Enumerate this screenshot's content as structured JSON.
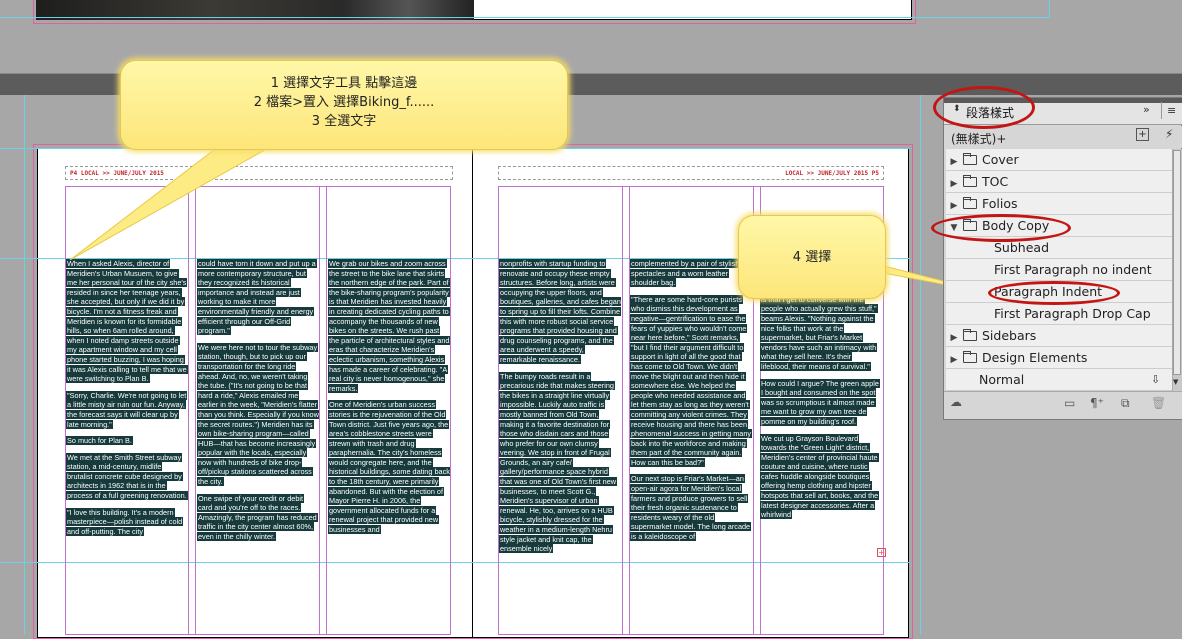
{
  "callout1": {
    "line1": "1 選擇文字工具 點擊這邊",
    "line2": "2 檔案>置入 選擇Biking_f......",
    "line3": "3 全選文字"
  },
  "callout2": {
    "text": "4 選擇"
  },
  "spread": {
    "left_folio": "P4     LOCAL >> JUNE/JULY 2015",
    "right_folio": "LOCAL >> JUNE/JULY 2015     P5",
    "columns": [
      [
        "When I asked Alexis, director of Meridien's Urban Musuem, to give me her personal tour of the city she's resided in since her teenage years, she accepted, but only if we did it by bicycle. I'm not a fitness freak and Meridien is known for its formidable hills, so when 6am rolled around, when I noted damp streets outside my apartment window and my cell phone started buzzing, I was hoping it was Alexis calling to tell me that we were switching to Plan B.",
        "\"Sorry, Charlie. We're not going to let a little misty air ruin our fun. Anyway, the forecast says it will clear up by late morning.\"",
        "So much for Plan B.",
        "We met at the Smith Street subway station, a mid-century, midlife brutalist concrete cube designed by architects in 1962 that is in the process of a full greening renovation.",
        "\"I love this building. It's a modern masterpiece—polish instead of cold and off-putting. The city"
      ],
      [
        "could have torn it down and put up a more contemporary structure, but they recognized its historical importance and instead are just working to make it more environmentally friendly and energy efficient through our Off-Grid program.\"",
        "We were here not to tour the subway station, though, but to pick up our transportation for the long ride ahead. And, no, we weren't taking the tube. (\"It's not going to be that hard a ride,\" Alexis emailed me earlier in the week, \"Meridien's flatter than you think. Especially if you know the secret routes.\") Meridien has its own bike-sharing program—called HUB—that has become increasingly popular with the locals, especially now with hundreds of bike drop-off/pickup stations scattered across the city.",
        "One swipe of your credit or debit card and you're off to the races. Amazingly, the program has reduced traffic in the city center almost 60%, even in the chilly winter."
      ],
      [
        "We grab our bikes and zoom across the street to the bike lane that skirts the northern edge of the park. Part of the bike-sharing program's popularity is that Meridien has invested heavily in creating dedicated cycling paths to accompany the thousands of new bikes on the streets. We rush past the particle of architectural styles and eras that characterize Meridien's eclectic urbanism, something Alexis has made a career of celebrating. \"A real city is never homogenous,\" she remarks.",
        "One of Meridien's urban success stories is the rejuvenation of the Old Town district. Just five years ago, the area's cobblestone streets were strewn with trash and drug paraphernalia. The city's homeless would congregate here, and the historical buildings, some dating back to the 18th century, were primarily abandoned. But with the election of Mayor Pierre H. in 2006, the government allocated funds for a renewal project that provided new businesses and"
      ],
      [
        "nonprofits with startup funding to renovate and occupy these empty structures. Before long, artists were occupying the upper floors, and boutiques, galleries, and cafes began to spring up to fill their lofts. Combine this with more robust social service programs that provided housing and drug counseling programs, and the area underwent a speedy, remarkable renaissance.",
        "The bumpy roads result in a precarious ride that makes steering the bikes in a straight line virtually impossible. Luckily auto traffic is mostly banned from Old Town, making it a favorite destination for those who disdain cars and those who prefer for our own clumsy veering. We stop in front of Frugal Grounds, an airy cafe/ gallery/performance space hybrid that was one of Old Town's first new businesses, to meet Scott G., Meridien's supervisor of urban renewal. He, too, arrives on a HUB bicycle, stylishly dressed for the weather in a medium-length Nehru style jacket and knit cap, the ensemble nicely"
      ],
      [
        "complemented by a pair of stylish spectacles and a worn leather shoulder bag.",
        "\"There are some hard-core purists who dismiss this development as negative—gentrification to ease the fears of yuppies who wouldn't come near here before,\" Scott remarks, \"but I find their argument difficult to support in light of all the good that has come to Old Town. We didn't move the blight out and then hide it somewhere else. We helped the people who needed assistance and let them stay as long as they weren't committing any violent crimes. They receive housing and there has been phenomenal success in getting many back into the workforce and making them part of the community again. How can this be bad?\"",
        "Our next stop is Friar's Market—an open-air agora for Meridien's local farmers and produce growers to sell their fresh organic sustenance to residents weary of the old supermarket model. The long arcade is a kaleidoscope of"
      ],
      [
        "stacked high with delicacies from the local fields.",
        "\"The best part of the experience here is that I get to converse with the people who actually grew this stuff,\" beams Alexis. \"Nothing against the nice folks that work at the supermarket, but Friar's Market vendors have such an intimacy with what they sell here. It's their lifeblood, their means of survival.\"",
        "How could I argue? The green apple I bought and consumed on the spot was so scrumptious it almost made me want to grow my own tree de pomme on my building's roof.",
        "We cut up Grayson Boulevard towards the \"Green Light\" district, Meridien's center of provincial haute couture and cuisine, where rustic cafes huddle alongside boutiques offering hemp clothing and hipster hotspots that sell art, books, and the latest designer accessories. After a whirlwind"
      ]
    ]
  },
  "panel": {
    "title": "段落樣式",
    "current_style": "(無樣式)+",
    "items": [
      {
        "label": "Cover",
        "type": "folder",
        "expanded": false
      },
      {
        "label": "TOC",
        "type": "folder",
        "expanded": false
      },
      {
        "label": "Folios",
        "type": "folder",
        "expanded": false
      },
      {
        "label": "Body Copy",
        "type": "folder",
        "expanded": true
      },
      {
        "label": "Subhead",
        "type": "style"
      },
      {
        "label": "First Paragraph no indent",
        "type": "style"
      },
      {
        "label": "Paragraph Indent",
        "type": "style"
      },
      {
        "label": "First Paragraph Drop Cap",
        "type": "style"
      },
      {
        "label": "Sidebars",
        "type": "folder",
        "expanded": false
      },
      {
        "label": "Design Elements",
        "type": "folder",
        "expanded": false
      },
      {
        "label": "Normal",
        "type": "style"
      }
    ],
    "bottom_icons": [
      "cloud-icon",
      "new-group-icon",
      "paragraph-override-icon",
      "new-style-icon",
      "trash-icon"
    ]
  }
}
